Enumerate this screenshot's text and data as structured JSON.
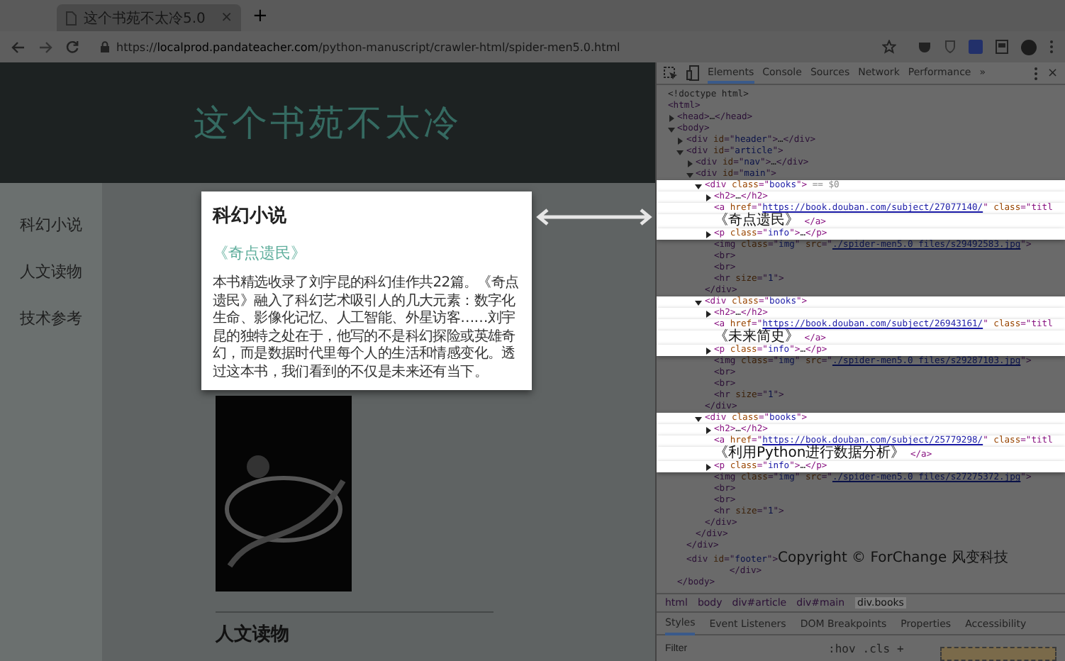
{
  "browser": {
    "tab_title": "这个书苑不太冷5.0",
    "tab_close": "×",
    "new_tab": "+",
    "url_scheme": "https://",
    "url_host": "localprod.pandateacher.com",
    "url_path": "/python-manuscript/crawler-html/spider-men5.0.html"
  },
  "page": {
    "site_title": "这个书苑不太冷",
    "nav": [
      "科幻小说",
      "人文读物",
      "技术参考"
    ],
    "section_heading": "科幻小说",
    "book_title": "《奇点遗民》",
    "book_info": "本书精选收录了刘宇昆的科幻佳作共22篇。《奇点遗民》融入了科幻艺术吸引人的几大元素：数字化生命、影像化记忆、人工智能、外星访客……刘宇昆的独特之处在于，他写的不是科幻探险或英雄奇幻，而是数据时代里每个人的生活和情感变化。透过这本书，我们看到的不仅是未来还有当下。",
    "next_heading": "人文读物"
  },
  "devtools": {
    "tabs": [
      {
        "label": "Elements",
        "selected": true
      },
      {
        "label": "Console",
        "selected": false
      },
      {
        "label": "Sources",
        "selected": false
      },
      {
        "label": "Network",
        "selected": false
      },
      {
        "label": "Performance",
        "selected": false
      }
    ],
    "more": "»",
    "close": "×",
    "dom": [
      {
        "kind": "leaf",
        "highlighted": false,
        "lines": [
          [
            {
              "comment": "<!doctype html>"
            }
          ]
        ]
      },
      {
        "kind": "leaf",
        "highlighted": false,
        "lines": [
          [
            {
              "tag": "<html>"
            }
          ]
        ],
        "children": [
          {
            "kind": "toggle",
            "expanded": false,
            "highlighted": false,
            "lines": [
              [
                {
                  "tag": "<head>"
                },
                {
                  "text": "…"
                },
                {
                  "tag": "</head>"
                }
              ]
            ]
          },
          {
            "kind": "toggle",
            "expanded": true,
            "highlighted": false,
            "lines": [
              [
                {
                  "tag": "<body>"
                }
              ]
            ],
            "close": [
              {
                "tag": "</body>"
              }
            ],
            "children": [
              {
                "kind": "toggle",
                "expanded": false,
                "highlighted": false,
                "lines": [
                  [
                    {
                      "tag": "<div "
                    },
                    {
                      "attr": "id"
                    },
                    {
                      "tag": "=\""
                    },
                    {
                      "value": "header"
                    },
                    {
                      "tag": "\">"
                    },
                    {
                      "text": "…"
                    },
                    {
                      "tag": "</div>"
                    }
                  ]
                ]
              },
              {
                "kind": "toggle",
                "expanded": true,
                "highlighted": false,
                "lines": [
                  [
                    {
                      "tag": "<div "
                    },
                    {
                      "attr": "id"
                    },
                    {
                      "tag": "=\""
                    },
                    {
                      "value": "article"
                    },
                    {
                      "tag": "\">"
                    }
                  ]
                ],
                "close": [
                  {
                    "tag": "</div>"
                  }
                ],
                "children": [
                  {
                    "kind": "toggle",
                    "expanded": false,
                    "highlighted": false,
                    "lines": [
                      [
                        {
                          "tag": "<div "
                        },
                        {
                          "attr": "id"
                        },
                        {
                          "tag": "=\""
                        },
                        {
                          "value": "nav"
                        },
                        {
                          "tag": "\">"
                        },
                        {
                          "text": "…"
                        },
                        {
                          "tag": "</div>"
                        }
                      ]
                    ]
                  },
                  {
                    "kind": "toggle",
                    "expanded": true,
                    "highlighted": false,
                    "lines": [
                      [
                        {
                          "tag": "<div "
                        },
                        {
                          "attr": "id"
                        },
                        {
                          "tag": "=\""
                        },
                        {
                          "value": "main"
                        },
                        {
                          "tag": "\">"
                        }
                      ]
                    ],
                    "close": [
                      {
                        "tag": "</div>"
                      }
                    ],
                    "children": [
                      {
                        "kind": "toggle",
                        "expanded": true,
                        "highlighted": true,
                        "lines": [
                          [
                            {
                              "tag": "<div "
                            },
                            {
                              "attr": "class"
                            },
                            {
                              "tag": "=\""
                            },
                            {
                              "value": "books"
                            },
                            {
                              "tag": "\">"
                            },
                            {
                              "dim": " == $0"
                            }
                          ]
                        ],
                        "close": [
                          {
                            "tag": "</div>"
                          }
                        ],
                        "children": [
                          {
                            "kind": "toggle",
                            "expanded": false,
                            "highlighted": true,
                            "lines": [
                              [
                                {
                                  "tag": "<h2>"
                                },
                                {
                                  "text": "…"
                                },
                                {
                                  "tag": "</h2>"
                                }
                              ]
                            ]
                          },
                          {
                            "kind": "leaf",
                            "highlighted": true,
                            "lines": [
                              [
                                {
                                  "tag": "<a "
                                },
                                {
                                  "attr": "href"
                                },
                                {
                                  "tag": "=\""
                                },
                                {
                                  "link": "https://book.douban.com/subject/27077140/"
                                },
                                {
                                  "tag": "\" "
                                },
                                {
                                  "attr": "class"
                                },
                                {
                                  "tag": "=\"titl"
                                }
                              ],
                              [
                                {
                                  "cjk": "《奇点遗民》"
                                },
                                {
                                  "tag": " </a>"
                                }
                              ]
                            ]
                          },
                          {
                            "kind": "toggle",
                            "expanded": false,
                            "highlighted": true,
                            "lines": [
                              [
                                {
                                  "tag": "<p "
                                },
                                {
                                  "attr": "class"
                                },
                                {
                                  "tag": "=\""
                                },
                                {
                                  "value": "info"
                                },
                                {
                                  "tag": "\">"
                                },
                                {
                                  "text": "…"
                                },
                                {
                                  "tag": "</p>"
                                }
                              ]
                            ]
                          },
                          {
                            "kind": "leaf",
                            "highlighted": false,
                            "lines": [
                              [
                                {
                                  "tag": "<img "
                                },
                                {
                                  "attr": "class"
                                },
                                {
                                  "tag": "=\""
                                },
                                {
                                  "value": "img"
                                },
                                {
                                  "tag": "\" "
                                },
                                {
                                  "attr": "src"
                                },
                                {
                                  "tag": "=\""
                                },
                                {
                                  "link": "./spider-men5.0_files/s29492583.jpg"
                                },
                                {
                                  "tag": "\">"
                                }
                              ]
                            ]
                          },
                          {
                            "kind": "leaf",
                            "highlighted": false,
                            "lines": [
                              [
                                {
                                  "tag": "<br>"
                                }
                              ]
                            ]
                          },
                          {
                            "kind": "leaf",
                            "highlighted": false,
                            "lines": [
                              [
                                {
                                  "tag": "<br>"
                                }
                              ]
                            ]
                          },
                          {
                            "kind": "leaf",
                            "highlighted": false,
                            "lines": [
                              [
                                {
                                  "tag": "<hr "
                                },
                                {
                                  "attr": "size"
                                },
                                {
                                  "tag": "=\""
                                },
                                {
                                  "value": "1"
                                },
                                {
                                  "tag": "\">"
                                }
                              ]
                            ]
                          }
                        ]
                      },
                      {
                        "kind": "toggle",
                        "expanded": true,
                        "highlighted": true,
                        "lines": [
                          [
                            {
                              "tag": "<div "
                            },
                            {
                              "attr": "class"
                            },
                            {
                              "tag": "=\""
                            },
                            {
                              "value": "books"
                            },
                            {
                              "tag": "\">"
                            }
                          ]
                        ],
                        "close": [
                          {
                            "tag": "</div>"
                          }
                        ],
                        "children": [
                          {
                            "kind": "toggle",
                            "expanded": false,
                            "highlighted": true,
                            "lines": [
                              [
                                {
                                  "tag": "<h2>"
                                },
                                {
                                  "text": "…"
                                },
                                {
                                  "tag": "</h2>"
                                }
                              ]
                            ]
                          },
                          {
                            "kind": "leaf",
                            "highlighted": true,
                            "lines": [
                              [
                                {
                                  "tag": "<a "
                                },
                                {
                                  "attr": "href"
                                },
                                {
                                  "tag": "=\""
                                },
                                {
                                  "link": "https://book.douban.com/subject/26943161/"
                                },
                                {
                                  "tag": "\" "
                                },
                                {
                                  "attr": "class"
                                },
                                {
                                  "tag": "=\"titl"
                                }
                              ],
                              [
                                {
                                  "cjk": "《未来简史》"
                                },
                                {
                                  "tag": " </a>"
                                }
                              ]
                            ]
                          },
                          {
                            "kind": "toggle",
                            "expanded": false,
                            "highlighted": true,
                            "lines": [
                              [
                                {
                                  "tag": "<p "
                                },
                                {
                                  "attr": "class"
                                },
                                {
                                  "tag": "=\""
                                },
                                {
                                  "value": "info"
                                },
                                {
                                  "tag": "\">"
                                },
                                {
                                  "text": "…"
                                },
                                {
                                  "tag": "</p>"
                                }
                              ]
                            ]
                          },
                          {
                            "kind": "leaf",
                            "highlighted": false,
                            "lines": [
                              [
                                {
                                  "tag": "<img "
                                },
                                {
                                  "attr": "class"
                                },
                                {
                                  "tag": "=\""
                                },
                                {
                                  "value": "img"
                                },
                                {
                                  "tag": "\" "
                                },
                                {
                                  "attr": "src"
                                },
                                {
                                  "tag": "=\""
                                },
                                {
                                  "link": "./spider-men5.0_files/s29287103.jpg"
                                },
                                {
                                  "tag": "\">"
                                }
                              ]
                            ]
                          },
                          {
                            "kind": "leaf",
                            "highlighted": false,
                            "lines": [
                              [
                                {
                                  "tag": "<br>"
                                }
                              ]
                            ]
                          },
                          {
                            "kind": "leaf",
                            "highlighted": false,
                            "lines": [
                              [
                                {
                                  "tag": "<br>"
                                }
                              ]
                            ]
                          },
                          {
                            "kind": "leaf",
                            "highlighted": false,
                            "lines": [
                              [
                                {
                                  "tag": "<hr "
                                },
                                {
                                  "attr": "size"
                                },
                                {
                                  "tag": "=\""
                                },
                                {
                                  "value": "1"
                                },
                                {
                                  "tag": "\">"
                                }
                              ]
                            ]
                          }
                        ]
                      },
                      {
                        "kind": "toggle",
                        "expanded": true,
                        "highlighted": true,
                        "lines": [
                          [
                            {
                              "tag": "<div "
                            },
                            {
                              "attr": "class"
                            },
                            {
                              "tag": "=\""
                            },
                            {
                              "value": "books"
                            },
                            {
                              "tag": "\">"
                            }
                          ]
                        ],
                        "close": [
                          {
                            "tag": "</div>"
                          }
                        ],
                        "children": [
                          {
                            "kind": "toggle",
                            "expanded": false,
                            "highlighted": true,
                            "lines": [
                              [
                                {
                                  "tag": "<h2>"
                                },
                                {
                                  "text": "…"
                                },
                                {
                                  "tag": "</h2>"
                                }
                              ]
                            ]
                          },
                          {
                            "kind": "leaf",
                            "highlighted": true,
                            "lines": [
                              [
                                {
                                  "tag": "<a "
                                },
                                {
                                  "attr": "href"
                                },
                                {
                                  "tag": "=\""
                                },
                                {
                                  "link": "https://book.douban.com/subject/25779298/"
                                },
                                {
                                  "tag": "\" "
                                },
                                {
                                  "attr": "class"
                                },
                                {
                                  "tag": "=\"titl"
                                }
                              ],
                              [
                                {
                                  "cjk": "《利用Python进行数据分析》"
                                },
                                {
                                  "tag": " </a>"
                                }
                              ]
                            ]
                          },
                          {
                            "kind": "toggle",
                            "expanded": false,
                            "highlighted": true,
                            "lines": [
                              [
                                {
                                  "tag": "<p "
                                },
                                {
                                  "attr": "class"
                                },
                                {
                                  "tag": "=\""
                                },
                                {
                                  "value": "info"
                                },
                                {
                                  "tag": "\">"
                                },
                                {
                                  "text": "…"
                                },
                                {
                                  "tag": "</p>"
                                }
                              ]
                            ]
                          },
                          {
                            "kind": "leaf",
                            "highlighted": false,
                            "lines": [
                              [
                                {
                                  "tag": "<img "
                                },
                                {
                                  "attr": "class"
                                },
                                {
                                  "tag": "=\""
                                },
                                {
                                  "value": "img"
                                },
                                {
                                  "tag": "\" "
                                },
                                {
                                  "attr": "src"
                                },
                                {
                                  "tag": "=\""
                                },
                                {
                                  "link": "./spider-men5.0_files/s27275372.jpg"
                                },
                                {
                                  "tag": "\">"
                                }
                              ]
                            ]
                          },
                          {
                            "kind": "leaf",
                            "highlighted": false,
                            "lines": [
                              [
                                {
                                  "tag": "<br>"
                                }
                              ]
                            ]
                          },
                          {
                            "kind": "leaf",
                            "highlighted": false,
                            "lines": [
                              [
                                {
                                  "tag": "<br>"
                                }
                              ]
                            ]
                          },
                          {
                            "kind": "leaf",
                            "highlighted": false,
                            "lines": [
                              [
                                {
                                  "tag": "<hr "
                                },
                                {
                                  "attr": "size"
                                },
                                {
                                  "tag": "=\""
                                },
                                {
                                  "value": "1"
                                },
                                {
                                  "tag": "\">"
                                }
                              ]
                            ]
                          }
                        ]
                      }
                    ]
                  }
                ]
              },
              {
                "kind": "leaf",
                "highlighted": false,
                "lines": [
                  [
                    {
                      "tag": "<div "
                    },
                    {
                      "attr": "id"
                    },
                    {
                      "tag": "=\""
                    },
                    {
                      "value": "footer"
                    },
                    {
                      "tag": "\">"
                    },
                    {
                      "cjk": "Copyright © ForChange 风变科技"
                    }
                  ],
                  [
                    {
                      "tag": "        </div>"
                    }
                  ]
                ]
              }
            ]
          }
        ]
      }
    ],
    "breadcrumb": [
      {
        "label": "html",
        "selected": false
      },
      {
        "label": "body",
        "selected": false
      },
      {
        "label": "div#article",
        "selected": false
      },
      {
        "label": "div#main",
        "selected": false
      },
      {
        "label": "div.books",
        "selected": true
      }
    ],
    "panel_tabs": [
      {
        "label": "Styles",
        "selected": true
      },
      {
        "label": "Event Listeners",
        "selected": false
      },
      {
        "label": "DOM Breakpoints",
        "selected": false
      },
      {
        "label": "Properties",
        "selected": false
      },
      {
        "label": "Accessibility",
        "selected": false
      }
    ],
    "filter_placeholder": "Filter",
    "hov": ":hov",
    "cls": ".cls",
    "add": "+"
  }
}
